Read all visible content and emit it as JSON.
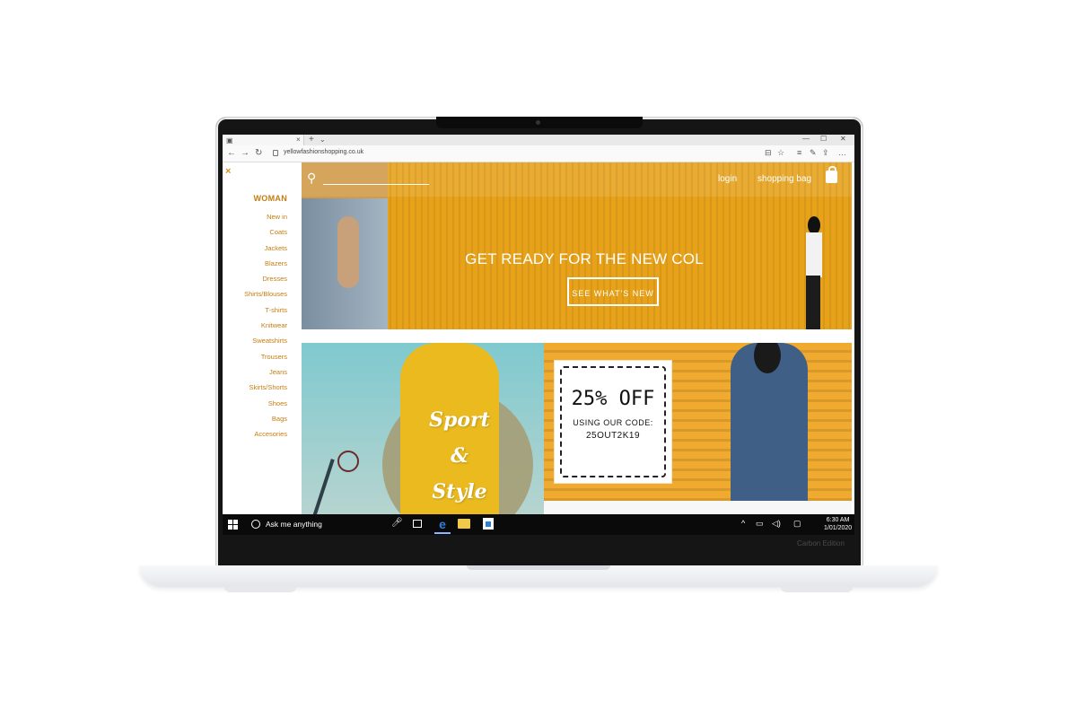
{
  "device": {
    "brand_text": "Carbon Edition"
  },
  "browser": {
    "tab_icon": "tab-page-icon",
    "tab_close": "×",
    "new_tab": "+",
    "tab_menu": "⌄",
    "window_controls": [
      "—",
      "☐",
      "✕"
    ],
    "nav": {
      "back": "←",
      "forward": "→",
      "refresh": "↻"
    },
    "url": "yellowfashionshopping.co.uk",
    "toolbar_icons": [
      "⊟",
      "☆",
      "≡",
      "✎",
      "⇪",
      "…"
    ]
  },
  "sidebar": {
    "close": "×",
    "title": "WOMAN",
    "items": [
      "New in",
      "Coats",
      "Jackets",
      "Blazers",
      "Dresses",
      "Shirts/Blouses",
      "T-shirts",
      "Knitwear",
      "Sweatshirts",
      "Trousers",
      "Jeans",
      "Skirts/Shorts",
      "Shoes",
      "Bags",
      "Accesories"
    ]
  },
  "header": {
    "search_icon": "search-icon",
    "login": "login",
    "shopping_bag": "shopping bag"
  },
  "hero": {
    "headline": "GET READY FOR THE NEW COL",
    "cta": "SEE WHAT'S NEW"
  },
  "promo_sport": {
    "line1": "Sport",
    "line2": "&",
    "line3": "Style"
  },
  "promo_coupon": {
    "title": "25% OFF",
    "line": "USING OUR CODE:",
    "code": "25OUT2K19"
  },
  "taskbar": {
    "search_placeholder": "Ask me anything",
    "tray_icons": [
      "^",
      "▭",
      "◁)",
      "▢"
    ],
    "time": "6:30 AM",
    "date": "1/01/2020"
  },
  "colors": {
    "accent": "#c47d12",
    "hero_bg": "#e7a21a",
    "promo_bg": "#f0aa30",
    "edge_blue": "#2d7fe0"
  }
}
